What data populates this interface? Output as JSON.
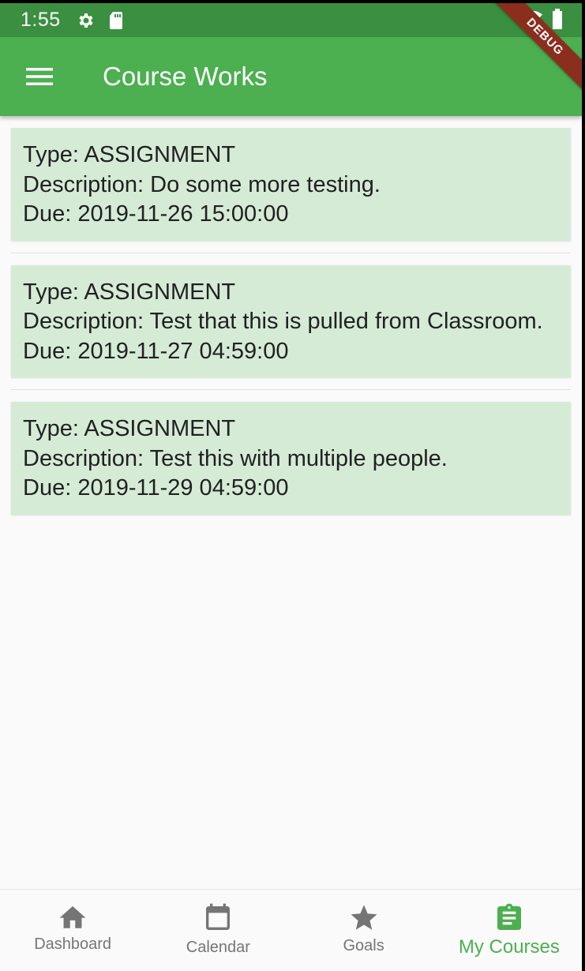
{
  "status_bar": {
    "time": "1:55",
    "icons": [
      "gear-icon",
      "sd-card-icon",
      "wifi-icon",
      "battery-icon"
    ]
  },
  "app_bar": {
    "title": "Course Works",
    "menu_icon": "hamburger-menu-icon"
  },
  "debug_banner": "DEBUG",
  "course_works": [
    {
      "type": "Type: ASSIGNMENT",
      "description": "Description: Do some more testing.",
      "due": "Due: 2019-11-26 15:00:00"
    },
    {
      "type": "Type: ASSIGNMENT",
      "description": "Description: Test that this is pulled from Classroom.",
      "due": "Due: 2019-11-27 04:59:00"
    },
    {
      "type": "Type: ASSIGNMENT",
      "description": "Description: Test this with multiple people.",
      "due": "Due: 2019-11-29 04:59:00"
    }
  ],
  "bottom_nav": {
    "items": [
      {
        "label": "Dashboard",
        "icon": "home-icon",
        "active": false
      },
      {
        "label": "Calendar",
        "icon": "calendar-icon",
        "active": false
      },
      {
        "label": "Goals",
        "icon": "star-icon",
        "active": false
      },
      {
        "label": "My Courses",
        "icon": "assignment-icon",
        "active": true
      }
    ]
  },
  "colors": {
    "primary": "#4caf50",
    "status_bar": "#3b8f40",
    "card": "#d5ebd6",
    "inactive": "#757575",
    "debug": "#8b2e1d"
  }
}
